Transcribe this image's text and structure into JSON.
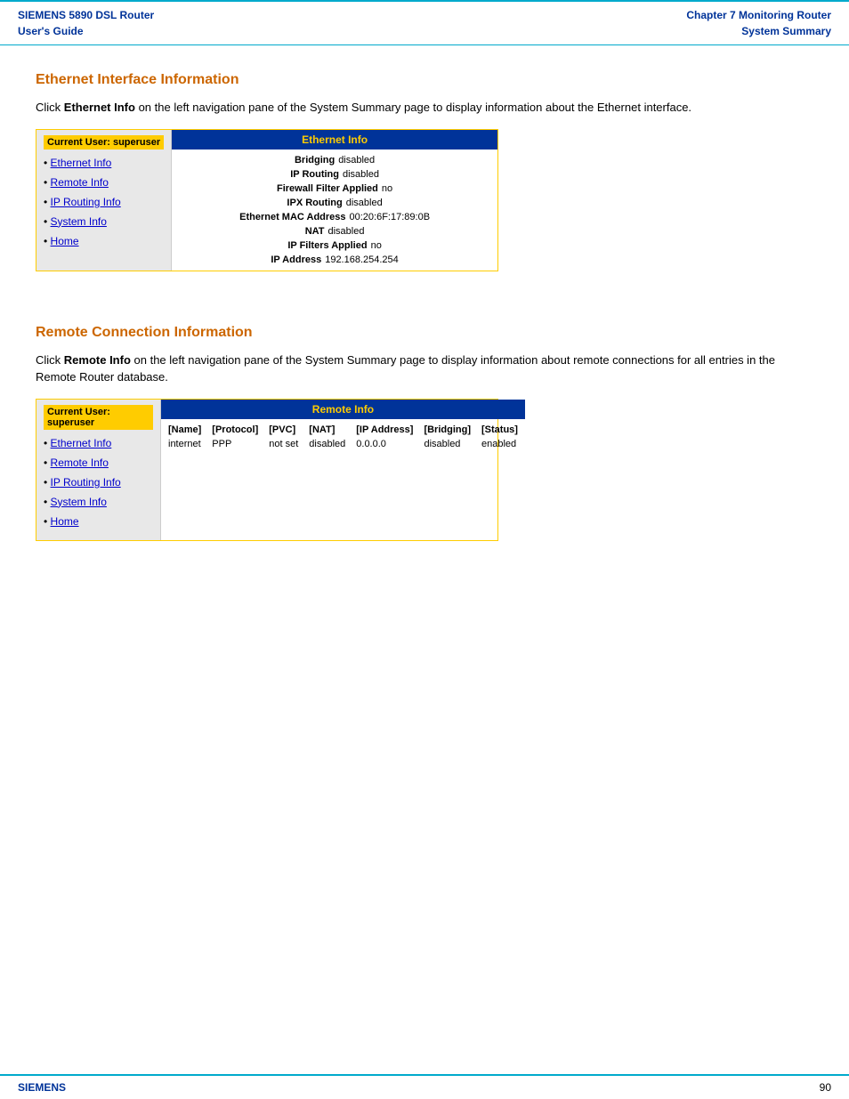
{
  "header": {
    "left_line1": "SIEMENS 5890 DSL Router",
    "left_line2": "User's Guide",
    "right_line1": "Chapter 7  Monitoring Router",
    "right_line2": "System Summary"
  },
  "footer": {
    "left": "SIEMENS",
    "right": "90"
  },
  "ethernet_section": {
    "title": "Ethernet Interface Information",
    "description_prefix": "Click ",
    "description_bold": "Ethernet Info",
    "description_suffix": " on the left navigation pane of the System Summary page to display information about the Ethernet interface.",
    "nav": {
      "current_user": "Current User:  superuser",
      "items": [
        {
          "label": "Ethernet Info",
          "href": "#"
        },
        {
          "label": "Remote Info",
          "href": "#"
        },
        {
          "label": "IP Routing Info",
          "href": "#"
        },
        {
          "label": "System Info",
          "href": "#"
        },
        {
          "label": "Home",
          "href": "#"
        }
      ]
    },
    "panel": {
      "title": "Ethernet Info",
      "rows": [
        {
          "label": "Bridging",
          "value": "disabled"
        },
        {
          "label": "IP Routing",
          "value": "disabled"
        },
        {
          "label": "Firewall Filter Applied",
          "value": "no"
        },
        {
          "label": "IPX Routing",
          "value": "disabled"
        },
        {
          "label": "Ethernet MAC Address",
          "value": "00:20:6F:17:89:0B"
        },
        {
          "label": "NAT",
          "value": "disabled"
        },
        {
          "label": "IP Filters Applied",
          "value": "no"
        },
        {
          "label": "IP Address",
          "value": "192.168.254.254"
        }
      ]
    }
  },
  "remote_section": {
    "title": "Remote Connection Information",
    "description_prefix": "Click ",
    "description_bold": "Remote Info",
    "description_suffix": " on the left navigation pane of the System Summary page to display information about remote connections for all entries in the Remote Router database.",
    "nav": {
      "current_user": "Current User:  superuser",
      "items": [
        {
          "label": "Ethernet Info",
          "href": "#"
        },
        {
          "label": "Remote Info",
          "href": "#"
        },
        {
          "label": "IP Routing Info",
          "href": "#"
        },
        {
          "label": "System Info",
          "href": "#"
        },
        {
          "label": "Home",
          "href": "#"
        }
      ]
    },
    "panel": {
      "title": "Remote Info",
      "columns": [
        "[Name]",
        "[Protocol]",
        "[PVC]",
        "[NAT]",
        "[IP Address]",
        "[Bridging]",
        "[Status]"
      ],
      "rows": [
        [
          "internet",
          "PPP",
          "not set",
          "disabled",
          "0.0.0.0",
          "disabled",
          "enabled"
        ]
      ]
    }
  }
}
